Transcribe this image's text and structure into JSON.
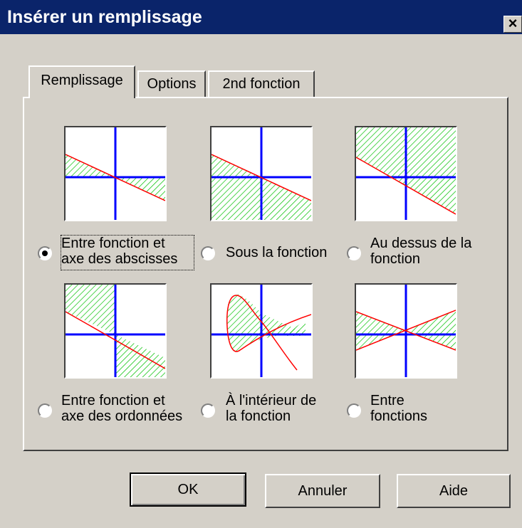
{
  "window": {
    "title": "Insérer un remplissage",
    "close_label": "×"
  },
  "tabs": [
    {
      "label": "Remplissage",
      "active": true
    },
    {
      "label": "Options",
      "active": false
    },
    {
      "label": "2nd fonction",
      "active": false
    }
  ],
  "options": [
    {
      "line1": "Entre fonction et",
      "line2": "axe des abscisses",
      "checked": true
    },
    {
      "line1": "Sous la fonction",
      "line2": "",
      "checked": false
    },
    {
      "line1": "Au dessus de la",
      "line2": "fonction",
      "checked": false
    },
    {
      "line1": "Entre fonction et",
      "line2": "axe des ordonnées",
      "checked": false
    },
    {
      "line1": "À l'intérieur de",
      "line2": "la fonction",
      "checked": false
    },
    {
      "line1": "Entre",
      "line2": "fonctions",
      "checked": false
    }
  ],
  "buttons": {
    "ok": "OK",
    "cancel": "Annuler",
    "help": "Aide"
  },
  "colors": {
    "title_bar": "#0a246a",
    "axis": "#0000ff",
    "curve": "#ff0000",
    "hatch": "#00c000"
  }
}
